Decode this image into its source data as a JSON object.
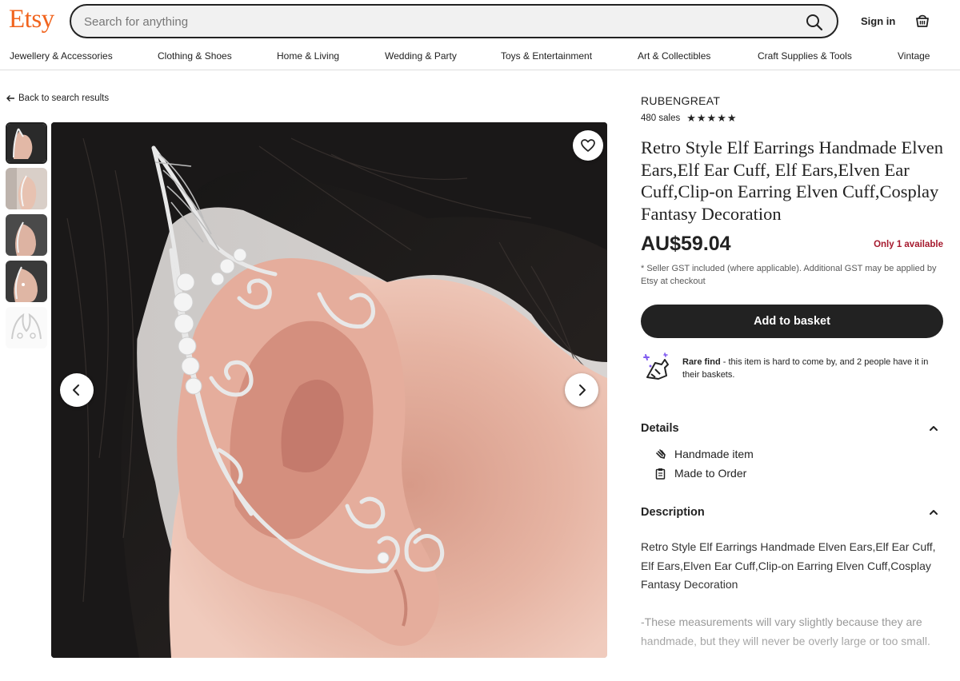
{
  "header": {
    "logo": "Etsy",
    "search_placeholder": "Search for anything",
    "sign_in": "Sign in"
  },
  "categories": [
    "Jewellery & Accessories",
    "Clothing & Shoes",
    "Home & Living",
    "Wedding & Party",
    "Toys & Entertainment",
    "Art & Collectibles",
    "Craft Supplies & Tools",
    "Vintage"
  ],
  "gallery": {
    "back_label": "Back to search results",
    "thumbnail_count": 5,
    "active_thumbnail": 1
  },
  "listing": {
    "shop_name": "RUBENGREAT",
    "sales": "480 sales",
    "rating_stars": 5,
    "title": "Retro Style Elf Earrings Handmade Elven Ears,Elf Ear Cuff, Elf Ears,Elven Ear Cuff,Clip-on Earring Elven Cuff,Cosplay Fantasy Decoration",
    "price": "AU$59.04",
    "availability": "Only 1 available",
    "gst_note": "* Seller GST included (where applicable). Additional GST may be applied by Etsy at checkout",
    "add_button": "Add to basket",
    "rare_find_bold": "Rare find",
    "rare_find_text": " - this item is hard to come by, and 2 people have it in their baskets."
  },
  "details": {
    "heading": "Details",
    "items": [
      "Handmade item",
      "Made to Order"
    ]
  },
  "description": {
    "heading": "Description",
    "text": "Retro Style Elf Earrings Handmade Elven Ears,Elf Ear Cuff, Elf Ears,Elven Ear Cuff,Clip-on Earring Elven Cuff,Cosplay Fantasy Decoration",
    "text2": "-These measurements will vary slightly because they are handmade, but they will never be overly large or too small."
  },
  "colors": {
    "brand": "#F1641E",
    "availability": "#A61A2E",
    "button": "#222222"
  },
  "icons": [
    "search-icon",
    "basket-icon",
    "heart-icon",
    "chevron-left-icon",
    "chevron-right-icon",
    "arrow-left-icon",
    "hand-icon",
    "clipboard-icon",
    "chevron-up-icon"
  ]
}
